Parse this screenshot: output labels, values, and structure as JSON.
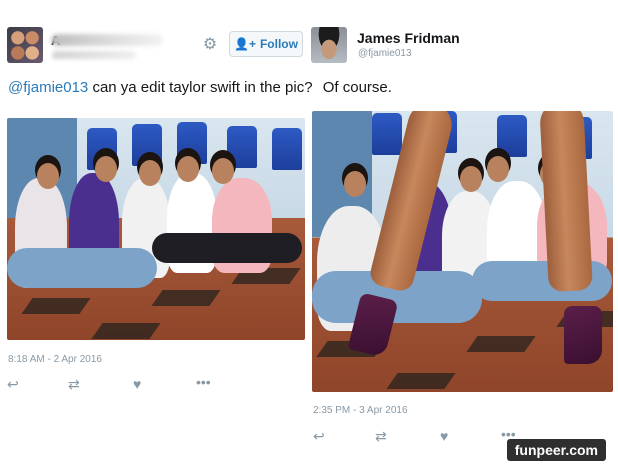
{
  "left_tweet": {
    "user_name_initial": "A",
    "follow_label": "Follow",
    "text_mention": "@fjamie013",
    "text_body": " can ya edit taylor swift in the pic?",
    "timestamp": "8:18 AM - 2 Apr 2016"
  },
  "right_tweet": {
    "user_name": "James Fridman",
    "handle": "@fjamie013",
    "text_body": "Of course.",
    "timestamp": "2:35 PM - 3 Apr 2016"
  },
  "icons": {
    "settings": "gear-icon",
    "follow": "add-person-icon",
    "reply": "reply-icon",
    "retweet": "retweet-icon",
    "like": "heart-icon",
    "more": "ellipsis-icon"
  },
  "colors": {
    "link": "#2b7bb9",
    "muted": "#8899a6",
    "text": "#14171a"
  },
  "watermark": "funpeer.com"
}
